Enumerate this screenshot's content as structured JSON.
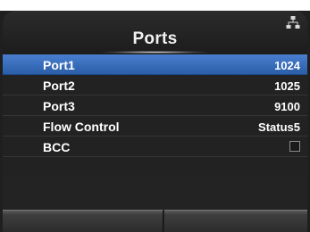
{
  "header": {
    "title": "Ports",
    "status_icon": "network-icon"
  },
  "settings": {
    "items": [
      {
        "label": "Port1",
        "value": "1024",
        "selected": true
      },
      {
        "label": "Port2",
        "value": "1025",
        "selected": false
      },
      {
        "label": "Port3",
        "value": "9100",
        "selected": false
      },
      {
        "label": "Flow Control",
        "value": "Status5",
        "selected": false
      },
      {
        "label": "BCC",
        "value": "",
        "type": "checkbox",
        "checked": false,
        "selected": false
      }
    ]
  },
  "softkeys": {
    "left_label": "",
    "right_label": ""
  },
  "colors": {
    "background": "#232323",
    "selection": "#3a6fc0",
    "text": "#ffffff"
  }
}
